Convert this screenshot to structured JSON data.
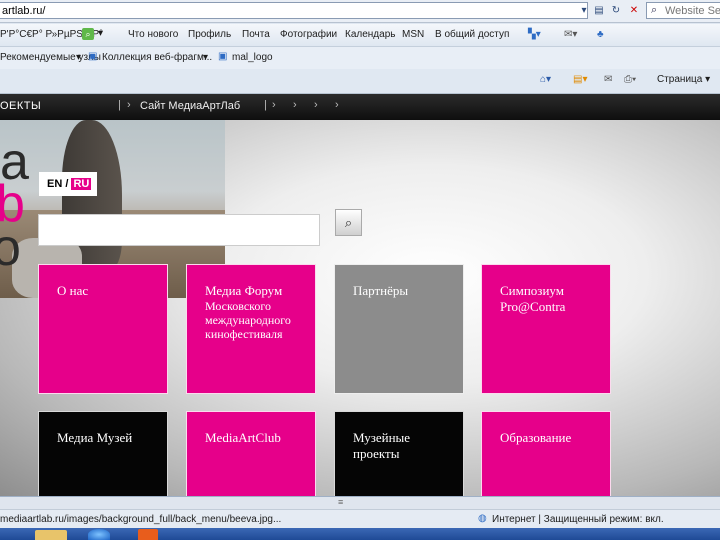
{
  "address_bar": {
    "url": "artlab.ru/",
    "search_placeholder": "Website Search"
  },
  "links_bar": {
    "current_tab": "Р'Р°С€Р° Р»РµРЅС‚Р°",
    "items": [
      "Что нового",
      "Профиль",
      "Почта",
      "Фотографии",
      "Календарь",
      "MSN",
      "В общий доступ"
    ]
  },
  "favorites_bar": {
    "items": [
      "Рекомендуемые узлы",
      "Коллекция веб-фрагм...",
      "mal_logo"
    ]
  },
  "command_bar": {
    "page_label": "Страница"
  },
  "site": {
    "nav_left": "ОЕКТЫ",
    "nav_link": "Сайт МедиаАртЛаб",
    "lang_en": "EN",
    "lang_sep": "/",
    "lang_ru": "RU",
    "hero_letters": [
      "a",
      "b",
      "o"
    ],
    "search_value": "",
    "tiles": [
      {
        "title": "О нас",
        "sub": "",
        "color": "#e6008a"
      },
      {
        "title": "Медиа Форум",
        "sub": "Московского международного кинофестиваля",
        "color": "#e6008a"
      },
      {
        "title": "Партнёры",
        "sub": "",
        "color": "#8c8c8c"
      },
      {
        "title": "Симпозиум Pro@Contra",
        "sub": "",
        "color": "#e6008a"
      },
      {
        "title": "Медиа Музей",
        "sub": "",
        "color": "#050505"
      },
      {
        "title": "MediaArtClub",
        "sub": "",
        "color": "#e6008a"
      },
      {
        "title": "Музейные проекты",
        "sub": "",
        "color": "#050505"
      },
      {
        "title": "Образование",
        "sub": "",
        "color": "#e6008a"
      }
    ]
  },
  "status_bar": {
    "url": "mediaartlab.ru/images/background_full/back_menu/beeva.jpg...",
    "zone": "Интернет | Защищенный режим: вкл."
  },
  "colors": {
    "accent": "#e6008a",
    "nav_bg": "#111111"
  }
}
